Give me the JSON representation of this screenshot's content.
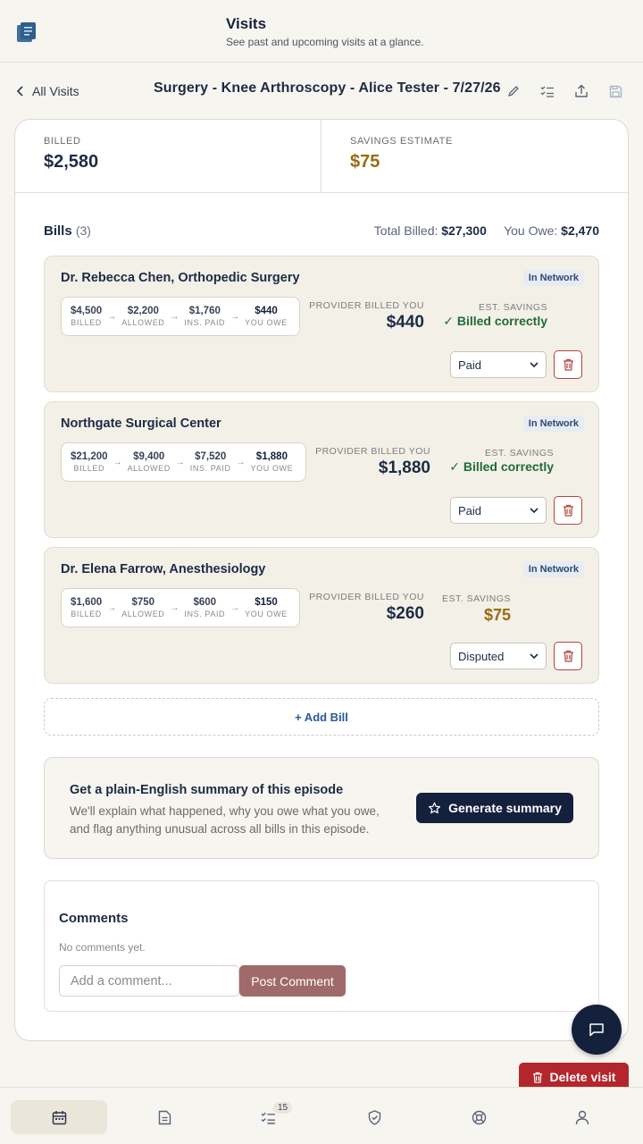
{
  "header": {
    "title": "Visits",
    "subtitle": "See past and upcoming visits at a glance.",
    "logo_icon": "document-stack-icon"
  },
  "breadcrumb": {
    "back_label": "All Visits"
  },
  "episode": {
    "title": "Surgery - Knee Arthroscopy - Alice Tester - 7/27/26",
    "tools": [
      "edit-icon",
      "checklist-icon",
      "share-icon",
      "save-icon"
    ]
  },
  "stats": {
    "billed_label": "BILLED",
    "billed_value": "$2,580",
    "savings_label": "SAVINGS ESTIMATE",
    "savings_value": "$75"
  },
  "bills_section": {
    "title": "Bills",
    "count": "(3)",
    "total_billed_label": "Total Billed:",
    "total_billed_value": "$27,300",
    "you_owe_label": "You Owe:",
    "you_owe_value": "$2,470"
  },
  "bills": [
    {
      "name": "Dr. Rebecca Chen, Orthopedic Surgery",
      "network": "In Network",
      "billed": "$4,500",
      "allowed": "$2,200",
      "ins_paid": "$1,760",
      "you_owe": "$440",
      "provider_billed_label": "PROVIDER BILLED YOU",
      "provider_billed": "$440",
      "est_savings_label": "EST. SAVINGS",
      "est_savings": "✓ Billed correctly",
      "status": "Paid"
    },
    {
      "name": "Northgate Surgical Center",
      "network": "In Network",
      "billed": "$21,200",
      "allowed": "$9,400",
      "ins_paid": "$7,520",
      "you_owe": "$1,880",
      "provider_billed_label": "PROVIDER BILLED YOU",
      "provider_billed": "$1,880",
      "est_savings_label": "EST. SAVINGS",
      "est_savings": "✓ Billed correctly",
      "status": "Paid"
    },
    {
      "name": "Dr. Elena Farrow, Anesthesiology",
      "network": "In Network",
      "billed": "$1,600",
      "allowed": "$750",
      "ins_paid": "$600",
      "you_owe": "$150",
      "provider_billed_label": "PROVIDER BILLED YOU",
      "provider_billed": "$260",
      "est_savings_label": "EST. SAVINGS",
      "est_savings": "$75",
      "status": "Disputed"
    }
  ],
  "flow_labels": {
    "billed": "BILLED",
    "allowed": "ALLOWED",
    "ins_paid": "INS. PAID",
    "you_owe": "YOU OWE"
  },
  "add_bill_label": "+ Add Bill",
  "summary": {
    "title": "Get a plain-English summary of this episode",
    "text": "We'll explain what happened, why you owe what you owe, and flag anything unusual across all bills in this episode.",
    "button_label": "Generate summary"
  },
  "comments": {
    "title": "Comments",
    "empty_text": "No comments yet.",
    "input_placeholder": "Add a comment...",
    "post_label": "Post Comment"
  },
  "delete_visit_label": "Delete visit",
  "bottom_nav": [
    {
      "icon": "calendar-icon",
      "active": true
    },
    {
      "icon": "document-icon"
    },
    {
      "icon": "checklist-icon",
      "badge": "15"
    },
    {
      "icon": "shield-check-icon"
    },
    {
      "icon": "lifebuoy-icon"
    },
    {
      "icon": "user-icon"
    }
  ],
  "colors": {
    "navy": "#14213d",
    "gold": "#9a6b10",
    "green": "#1f6b3a",
    "red": "#b3262b",
    "link": "#2a5a9a"
  }
}
